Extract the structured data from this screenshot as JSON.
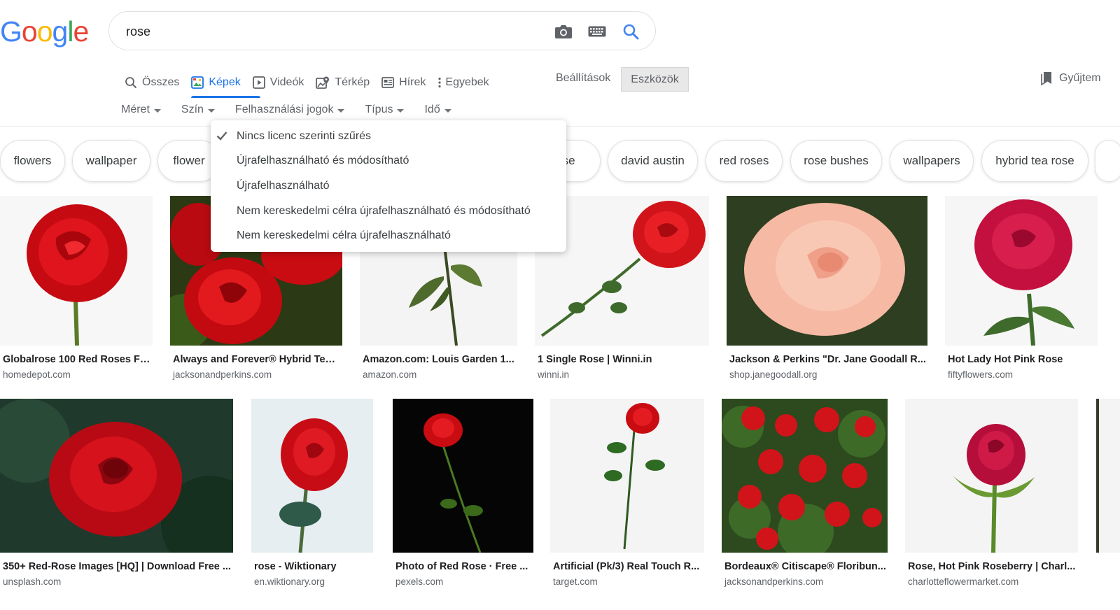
{
  "logo": {
    "text": "Google"
  },
  "search": {
    "query": "rose"
  },
  "tabs": [
    {
      "label": "Összes",
      "icon": "search-icon"
    },
    {
      "label": "Képek",
      "icon": "image-icon",
      "active": true
    },
    {
      "label": "Videók",
      "icon": "play-icon"
    },
    {
      "label": "Térkép",
      "icon": "map-icon"
    },
    {
      "label": "Hírek",
      "icon": "news-icon"
    },
    {
      "label": "Egyebek",
      "icon": "more-vert-icon"
    }
  ],
  "settings_label": "Beállítások",
  "tools_label": "Eszközök",
  "collections_label": "Gyűjtem",
  "filters": [
    "Méret",
    "Szín",
    "Felhasználási jogok",
    "Típus",
    "Idő"
  ],
  "chips": [
    "flowers",
    "wallpaper",
    "flower",
    "rose",
    "david austin",
    "red roses",
    "rose bushes",
    "wallpapers",
    "hybrid tea rose"
  ],
  "usage_rights_menu": [
    {
      "label": "Nincs licenc szerinti szűrés",
      "checked": true
    },
    {
      "label": "Újrafelhasználható és módosítható",
      "checked": false
    },
    {
      "label": "Újrafelhasználható",
      "checked": false
    },
    {
      "label": "Nem kereskedelmi célra újrafelhasználható és módosítható",
      "checked": false
    },
    {
      "label": "Nem kereskedelmi célra újrafelhasználható",
      "checked": false
    }
  ],
  "results": [
    {
      "title": "Globalrose 100 Red Roses Fr...",
      "source": "homedepot.com"
    },
    {
      "title": "Always and Forever® Hybrid Tea ...",
      "source": "jacksonandperkins.com"
    },
    {
      "title": "Amazon.com: Louis Garden 1...",
      "source": "amazon.com"
    },
    {
      "title": "1 Single Rose | Winni.in",
      "source": "winni.in"
    },
    {
      "title": "Jackson & Perkins \"Dr. Jane Goodall R...",
      "source": "shop.janegoodall.org"
    },
    {
      "title": "Hot Lady Hot Pink Rose",
      "source": "fiftyflowers.com"
    },
    {
      "title": "350+ Red-Rose Images [HQ] | Download Free ...",
      "source": "unsplash.com"
    },
    {
      "title": "rose - Wiktionary",
      "source": "en.wiktionary.org"
    },
    {
      "title": "Photo of Red Rose · Free ...",
      "source": "pexels.com"
    },
    {
      "title": "Artificial (Pk/3) Real Touch R...",
      "source": "target.com"
    },
    {
      "title": "Bordeaux® Citiscape® Floribun...",
      "source": "jacksonandperkins.com"
    },
    {
      "title": "Rose, Hot Pink Roseberry | Charl...",
      "source": "charlotteflowermarket.com"
    }
  ],
  "colors": {
    "accent": "#1a73e8",
    "rose_red": "#d0101a",
    "pink": "#f4b39e",
    "hot_pink": "#c4103e"
  }
}
